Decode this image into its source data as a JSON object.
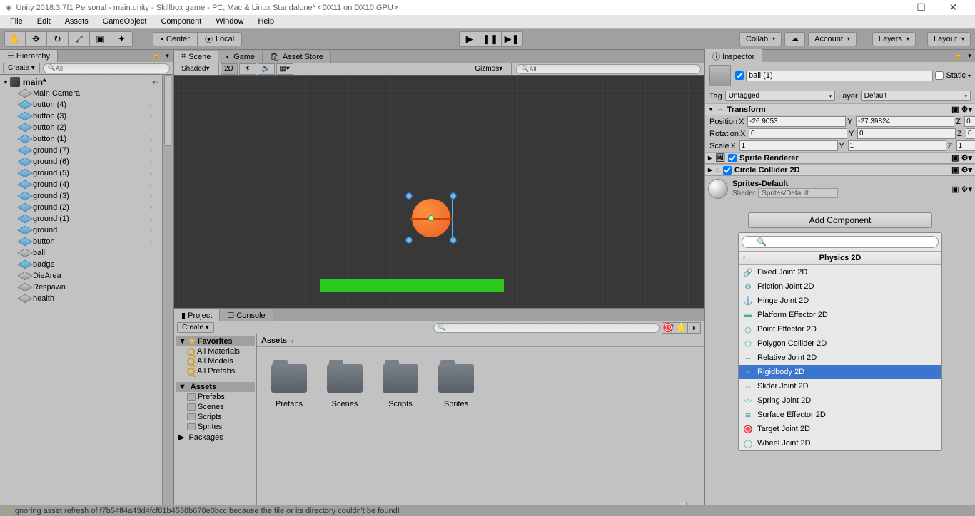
{
  "window": {
    "title": "Unity 2018.3.7f1 Personal - main.unity - Skillbox game - PC, Mac & Linux Standalone* <DX11 on DX10 GPU>"
  },
  "menu": [
    "File",
    "Edit",
    "Assets",
    "GameObject",
    "Component",
    "Window",
    "Help"
  ],
  "toolbar": {
    "pivot_center": "Center",
    "pivot_local": "Local",
    "collab": "Collab",
    "account": "Account",
    "layers": "Layers",
    "layout": "Layout"
  },
  "hierarchy": {
    "title": "Hierarchy",
    "create": "Create",
    "search": "All",
    "scene": "main*",
    "items": [
      {
        "name": "Main Camera",
        "blue": false,
        "expandable": false
      },
      {
        "name": "button (4)",
        "blue": true,
        "expandable": true
      },
      {
        "name": "button (3)",
        "blue": true,
        "expandable": true
      },
      {
        "name": "button (2)",
        "blue": true,
        "expandable": true
      },
      {
        "name": "button (1)",
        "blue": true,
        "expandable": true
      },
      {
        "name": "ground (7)",
        "blue": true,
        "expandable": true
      },
      {
        "name": "ground (6)",
        "blue": true,
        "expandable": true
      },
      {
        "name": "ground (5)",
        "blue": true,
        "expandable": true
      },
      {
        "name": "ground (4)",
        "blue": true,
        "expandable": true
      },
      {
        "name": "ground (3)",
        "blue": true,
        "expandable": true
      },
      {
        "name": "ground (2)",
        "blue": true,
        "expandable": true
      },
      {
        "name": "ground (1)",
        "blue": true,
        "expandable": true
      },
      {
        "name": "ground",
        "blue": true,
        "expandable": true
      },
      {
        "name": "button",
        "blue": true,
        "expandable": true
      },
      {
        "name": "ball",
        "blue": false,
        "expandable": false
      },
      {
        "name": "badge",
        "blue": true,
        "expandable": false
      },
      {
        "name": "DieArea",
        "blue": false,
        "expandable": false
      },
      {
        "name": "Respawn",
        "blue": false,
        "expandable": false
      },
      {
        "name": "health",
        "blue": false,
        "expandable": false
      }
    ]
  },
  "scene_panel": {
    "tabs": {
      "scene": "Scene",
      "game": "Game",
      "asset_store": "Asset Store"
    },
    "shaded": "Shaded",
    "mode_2d": "2D",
    "gizmos": "Gizmos",
    "search": "All"
  },
  "project": {
    "tab1": "Project",
    "tab2": "Console",
    "create": "Create",
    "favorites": "Favorites",
    "fav_items": [
      "All Materials",
      "All Models",
      "All Prefabs"
    ],
    "assets": "Assets",
    "asset_folders": [
      "Prefabs",
      "Scenes",
      "Scripts",
      "Sprites"
    ],
    "packages": "Packages",
    "breadcrumb": "Assets",
    "folders": [
      "Prefabs",
      "Scenes",
      "Scripts",
      "Sprites"
    ]
  },
  "inspector": {
    "title": "Inspector",
    "go_name": "ball (1)",
    "static": "Static",
    "tag_label": "Tag",
    "tag": "Untagged",
    "layer_label": "Layer",
    "layer": "Default",
    "transform": {
      "label": "Transform",
      "position": "Position",
      "rotation": "Rotation",
      "scale": "Scale",
      "pos": {
        "x": "-26.9053",
        "y": "-27.39824",
        "z": "0"
      },
      "rot": {
        "x": "0",
        "y": "0",
        "z": "0"
      },
      "scl": {
        "x": "1",
        "y": "1",
        "z": "1"
      }
    },
    "sprite_renderer": "Sprite Renderer",
    "circle_collider": "Circle Collider 2D",
    "material": {
      "name": "Sprites-Default",
      "shader_label": "Shader",
      "shader": "Sprites/Default"
    },
    "add_component": "Add Component",
    "menu_category": "Physics 2D",
    "menu_items": [
      "Fixed Joint 2D",
      "Friction Joint 2D",
      "Hinge Joint 2D",
      "Platform Effector 2D",
      "Point Effector 2D",
      "Polygon Collider 2D",
      "Relative Joint 2D",
      "Rigidbody 2D",
      "Slider Joint 2D",
      "Spring Joint 2D",
      "Surface Effector 2D",
      "Target Joint 2D",
      "Wheel Joint 2D"
    ],
    "menu_selected": 7
  },
  "status": {
    "warn_text": "Ignoring asset refresh of f7b54ff4a43d4fcf81b4538b678e0bcc because the file or its directory couldn't be found!"
  }
}
